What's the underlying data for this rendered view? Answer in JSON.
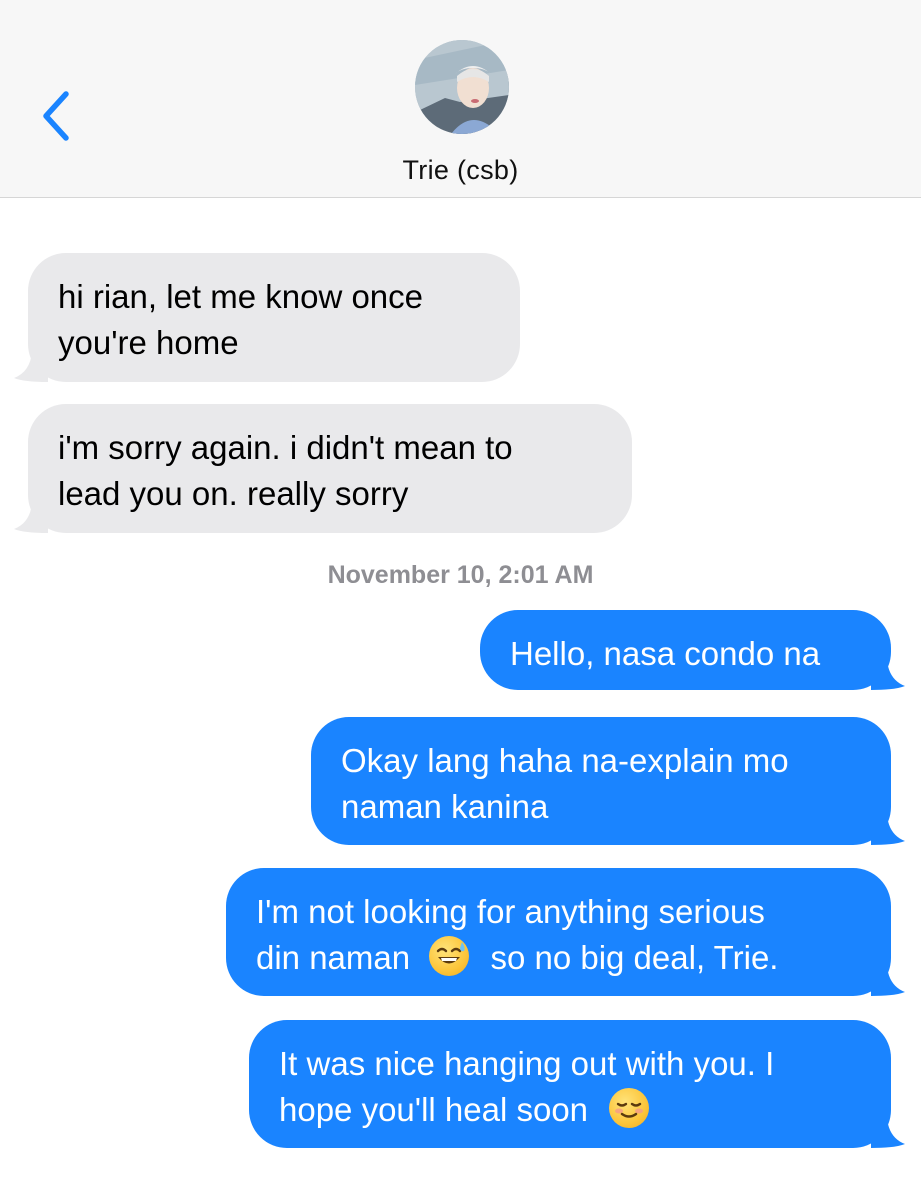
{
  "header": {
    "back_icon": "chevron-left-icon",
    "contact_name": "Trie (csb)",
    "accent_color": "#1a84ff"
  },
  "messages": [
    {
      "direction": "incoming",
      "lines": [
        "hi rian, let me know once",
        "you're home"
      ]
    },
    {
      "direction": "incoming",
      "lines": [
        "i'm sorry again. i didn't mean to",
        "lead you on. really sorry"
      ]
    },
    {
      "timestamp": "November 10, 2:01 AM"
    },
    {
      "direction": "outgoing",
      "lines": [
        "Hello, nasa condo na"
      ]
    },
    {
      "direction": "outgoing",
      "lines": [
        "Okay lang haha na-explain mo",
        "naman kanina"
      ]
    },
    {
      "direction": "outgoing",
      "lines": [
        "I'm not looking for anything serious",
        "din naman",
        "so no big deal, Trie."
      ],
      "emoji": "sweat-smile-emoji"
    },
    {
      "direction": "outgoing",
      "lines": [
        "It was nice hanging out with you. I",
        "hope you'll heal soon"
      ],
      "emoji": "smiling-face-emoji"
    }
  ]
}
